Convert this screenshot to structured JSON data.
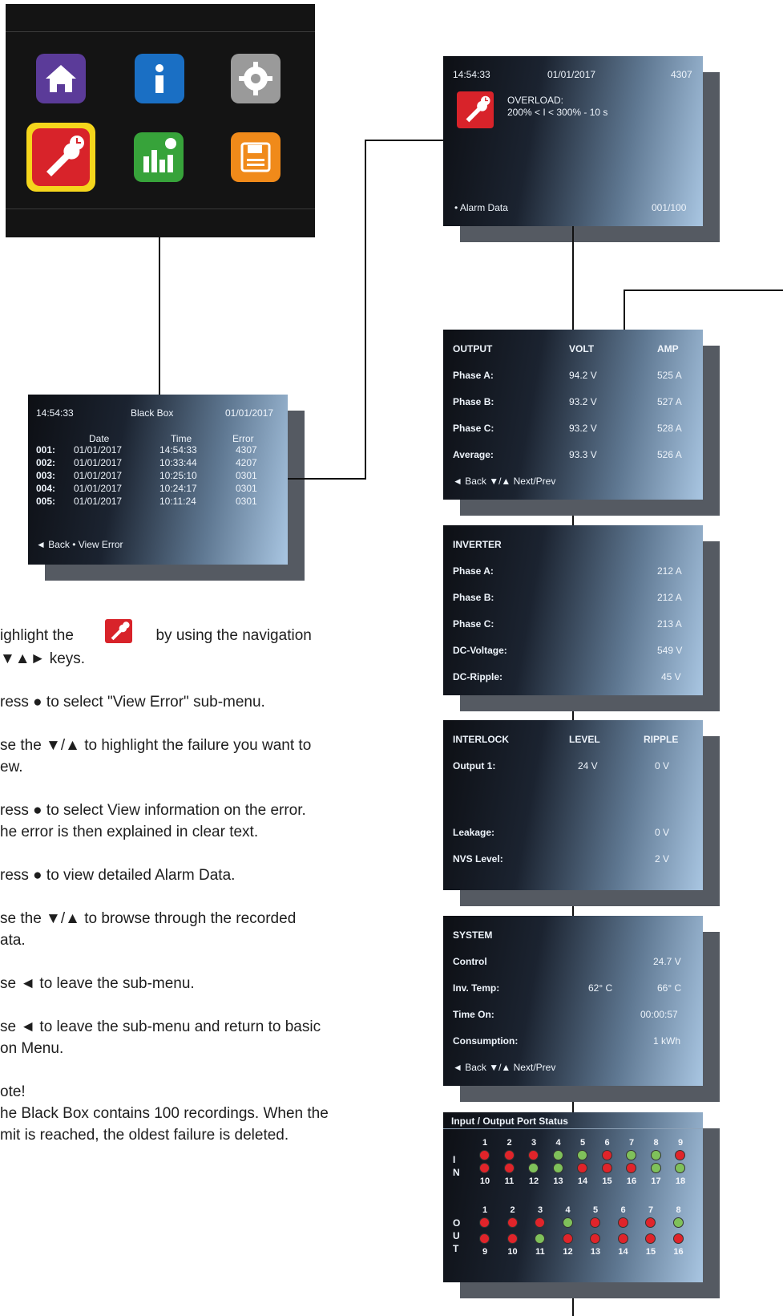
{
  "menu": {
    "icons": [
      "home-icon",
      "info-icon",
      "settings-icon",
      "black-box-icon",
      "statistics-icon",
      "save-icon"
    ]
  },
  "blackbox": {
    "time": "14:54:33",
    "title": "Black Box",
    "date": "01/01/2017",
    "col_date": "Date",
    "col_time": "Time",
    "col_error": "Error",
    "rows": [
      {
        "n": "001:",
        "date": "01/01/2017",
        "time": "14:54:33",
        "err": "4307"
      },
      {
        "n": "002:",
        "date": "01/01/2017",
        "time": "10:33:44",
        "err": "4207"
      },
      {
        "n": "003:",
        "date": "01/01/2017",
        "time": "10:25:10",
        "err": "0301"
      },
      {
        "n": "004:",
        "date": "01/01/2017",
        "time": "10:24:17",
        "err": "0301"
      },
      {
        "n": "005:",
        "date": "01/01/2017",
        "time": "10:11:24",
        "err": "0301"
      }
    ],
    "footer": "◄ Back  • View Error"
  },
  "alarm": {
    "time": "14:54:33",
    "date": "01/01/2017",
    "code": "4307",
    "title": "OVERLOAD:",
    "detail": "200% < I < 300% - 10 s",
    "footer_left": "• Alarm Data",
    "footer_right": "001/100"
  },
  "output": {
    "h1": "OUTPUT",
    "h2": "VOLT",
    "h3": "AMP",
    "rows": [
      {
        "label": "Phase A:",
        "volt": "94.2 V",
        "amp": "525 A"
      },
      {
        "label": "Phase B:",
        "volt": "93.2 V",
        "amp": "527 A"
      },
      {
        "label": "Phase C:",
        "volt": "93.2 V",
        "amp": "528 A"
      },
      {
        "label": "Average:",
        "volt": "93.3 V",
        "amp": "526 A"
      }
    ],
    "footer": "◄ Back  ▼/▲ Next/Prev"
  },
  "inverter": {
    "h1": "INVERTER",
    "rows": [
      {
        "label": "Phase A:",
        "val": "212 A"
      },
      {
        "label": "Phase B:",
        "val": "212 A"
      },
      {
        "label": "Phase C:",
        "val": "213 A"
      },
      {
        "label": "DC-Voltage:",
        "val": "549 V"
      },
      {
        "label": "DC-Ripple:",
        "val": "45 V"
      }
    ]
  },
  "interlock": {
    "h1": "INTERLOCK",
    "h2": "LEVEL",
    "h3": "RIPPLE",
    "output1_label": "Output 1:",
    "output1_level": "24 V",
    "output1_ripple": "0 V",
    "leakage_label": "Leakage:",
    "leakage_val": "0 V",
    "nvs_label": "NVS Level:",
    "nvs_val": "2 V"
  },
  "system": {
    "h1": "SYSTEM",
    "rows": [
      {
        "label": "Control",
        "mid": "",
        "val": "24.7 V"
      },
      {
        "label": "Inv. Temp:",
        "mid": "62° C",
        "val": "66° C"
      },
      {
        "label": "Time On:",
        "mid": "",
        "val": "00:00:57"
      },
      {
        "label": "Consumption:",
        "mid": "",
        "val": "1 kWh"
      }
    ],
    "footer": "◄ Back  ▼/▲ Next/Prev"
  },
  "ports": {
    "title": "Input / Output Port Status",
    "in_label": [
      "I",
      "N"
    ],
    "out_label": [
      "O",
      "U",
      "T"
    ],
    "in_top_nums": [
      "1",
      "2",
      "3",
      "4",
      "5",
      "6",
      "7",
      "8",
      "9"
    ],
    "in_bottom_nums": [
      "10",
      "11",
      "12",
      "13",
      "14",
      "15",
      "16",
      "17",
      "18"
    ],
    "in_top": [
      "r",
      "r",
      "r",
      "g",
      "g",
      "r",
      "g",
      "g",
      "r"
    ],
    "in_bottom": [
      "r",
      "r",
      "g",
      "g",
      "r",
      "r",
      "r",
      "g",
      "g"
    ],
    "out_top_nums": [
      "1",
      "2",
      "3",
      "4",
      "5",
      "6",
      "7",
      "8"
    ],
    "out_bottom_nums": [
      "9",
      "10",
      "11",
      "12",
      "13",
      "14",
      "15",
      "16"
    ],
    "out_top": [
      "r",
      "r",
      "r",
      "g",
      "r",
      "r",
      "r",
      "g"
    ],
    "out_bottom": [
      "r",
      "r",
      "g",
      "r",
      "r",
      "r",
      "r",
      "r"
    ]
  },
  "steps": {
    "s1a": "ighlight  the",
    "s1b": "by using the navigation",
    "s1c": "▼▲► keys.",
    "s2": "ress ● to select \"View Error\" sub-menu.",
    "s3a": "se the ▼/▲ to highlight the failure you want to",
    "s3b": "ew.",
    "s4a": "ress ● to select View information on the error.",
    "s4b": "he error is then explained in clear text.",
    "s5": "ress ● to view detailed Alarm Data.",
    "s6a": "se the ▼/▲ to browse through the recorded",
    "s6b": "ata.",
    "s7": "se ◄ to leave the sub-menu.",
    "s8a": "se ◄ to leave the sub-menu and return to basic",
    "s8b": "on Menu.",
    "note": "ote!",
    "n1": "he Black Box contains 100 recordings. When the",
    "n2": "mit is reached, the oldest failure is deleted."
  }
}
